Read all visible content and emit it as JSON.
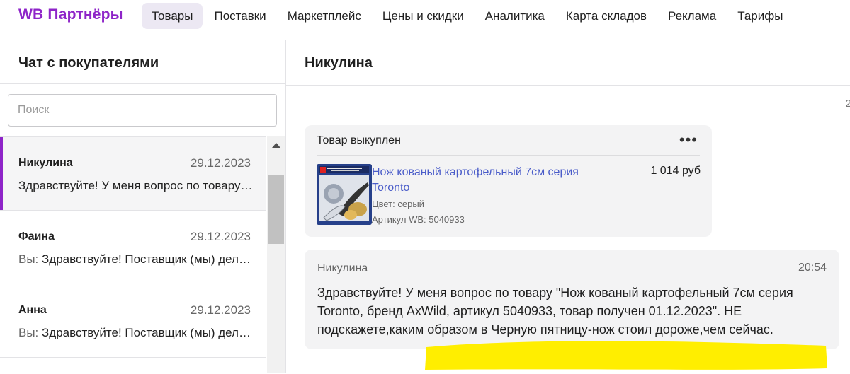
{
  "app": {
    "logo": "WB Партнёры"
  },
  "nav": {
    "items": [
      {
        "label": "Товары",
        "active": true
      },
      {
        "label": "Поставки"
      },
      {
        "label": "Маркетплейс"
      },
      {
        "label": "Цены и скидки"
      },
      {
        "label": "Аналитика"
      },
      {
        "label": "Карта складов"
      },
      {
        "label": "Реклама"
      },
      {
        "label": "Тарифы"
      }
    ]
  },
  "sidebar": {
    "title": "Чат с покупателями",
    "search_placeholder": "Поиск",
    "chats": [
      {
        "name": "Никулина",
        "date": "29.12.2023",
        "you_prefix": "",
        "preview": "Здравствуйте! У меня вопрос по товару \"Нож кованый картофельный 7см серия Toronto\"",
        "active": true
      },
      {
        "name": "Фаина",
        "date": "29.12.2023",
        "you_prefix": "Вы: ",
        "preview": "Здравствуйте! Поставщик (мы) делаем всё",
        "active": false
      },
      {
        "name": "Анна",
        "date": "29.12.2023",
        "you_prefix": "Вы: ",
        "preview": "Здравствуйте! Поставщик (мы) делаем всё",
        "active": false
      }
    ]
  },
  "conversation": {
    "title": "Никулина",
    "edge_digit": "2",
    "order": {
      "status": "Товар выкуплен",
      "menu_icon": "more-dots-icon",
      "product_name": "Нож кованый картофельный 7см серия Toronto",
      "price": "1 014 руб",
      "color": "Цвет: серый",
      "article": "Артикул WB: 5040933"
    },
    "message": {
      "author": "Никулина",
      "time": "20:54",
      "text": "Здравствуйте! У меня вопрос по товару \"Нож кованый картофельный 7см серия Toronto, бренд AxWild, артикул 5040933, товар получен 01.12.2023\". НЕ подскажете,каким образом в Черную пятницу-нож стоил дороже,чем сейчас."
    }
  },
  "colors": {
    "brand": "#8e24c8",
    "link": "#4a5cc9",
    "highlight": "#ffee00"
  }
}
